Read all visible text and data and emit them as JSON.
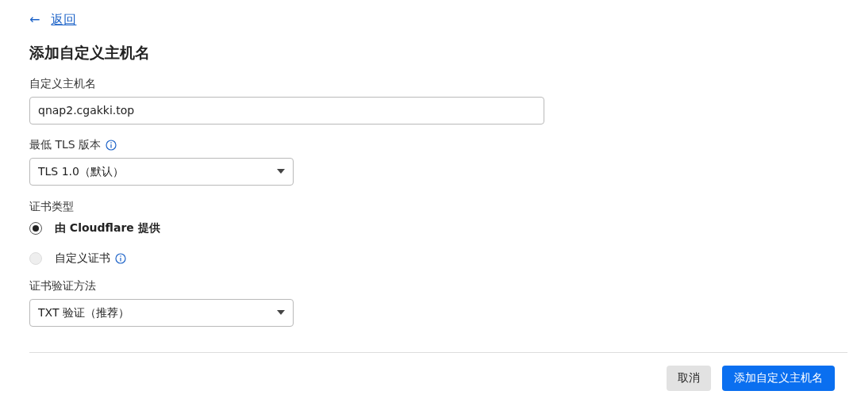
{
  "back_link": {
    "icon": "←",
    "label": "返回"
  },
  "title": "添加自定义主机名",
  "hostname": {
    "label": "自定义主机名",
    "value": "qnap2.cgakki.top"
  },
  "tls": {
    "label": "最低 TLS 版本",
    "info": true,
    "value": "TLS 1.0（默认）"
  },
  "certificate_type": {
    "label": "证书类型",
    "options": [
      {
        "label": "由 Cloudflare 提供",
        "selected": true,
        "info": false
      },
      {
        "label": "自定义证书",
        "selected": false,
        "info": true
      }
    ]
  },
  "validation": {
    "label": "证书验证方法",
    "info": false,
    "value": "TXT 验证（推荐）"
  },
  "buttons": [
    {
      "kind": "secondary",
      "label": "取消"
    },
    {
      "kind": "primary",
      "label": "添加自定义主机名"
    }
  ]
}
